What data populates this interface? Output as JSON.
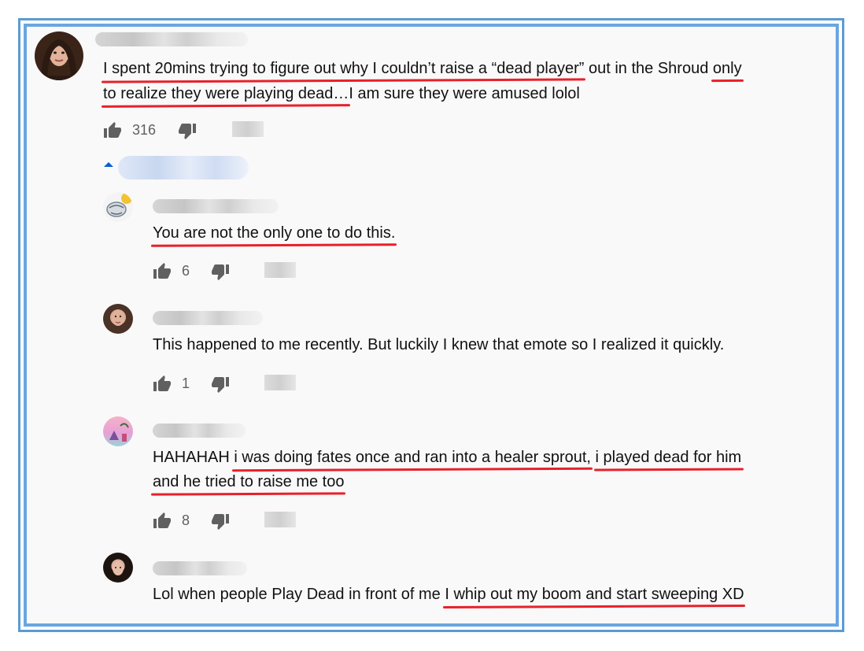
{
  "colors": {
    "frame_border": "#5b9bd5",
    "underline": "#e8202a",
    "link_blue": "#065fd4",
    "icon_gray": "#606060"
  },
  "comment": {
    "line1": {
      "u1": "I spent 20mins trying to figure out why I couldn’t raise a “dead player”",
      "t1": " out in the Shroud ",
      "u2": "only"
    },
    "line2": {
      "u1": "to realize they were playing dead…",
      "t1": "I am sure they were amused lolol"
    },
    "likes": "316"
  },
  "replies": [
    {
      "text": "You are not the only one to do this.",
      "likes": "6"
    },
    {
      "text": "This happened to me recently. But luckily I knew that emote so I realized it quickly.",
      "likes": "1"
    },
    {
      "line1": {
        "t1": "HAHAHAH ",
        "u1": "i was doing fates once and ran into a healer sprout,",
        "t2": " ",
        "u2": "i played dead for him"
      },
      "line2": {
        "u1": "and he tried to raise me too"
      },
      "likes": "8"
    },
    {
      "line1": {
        "t1": "Lol when people Play Dead in front of me ",
        "u1": "I whip out my boom and start sweeping XD"
      }
    }
  ],
  "icons": {
    "like": "thumbs-up-icon",
    "dislike": "thumbs-down-icon",
    "toggle": "caret-up-icon"
  }
}
